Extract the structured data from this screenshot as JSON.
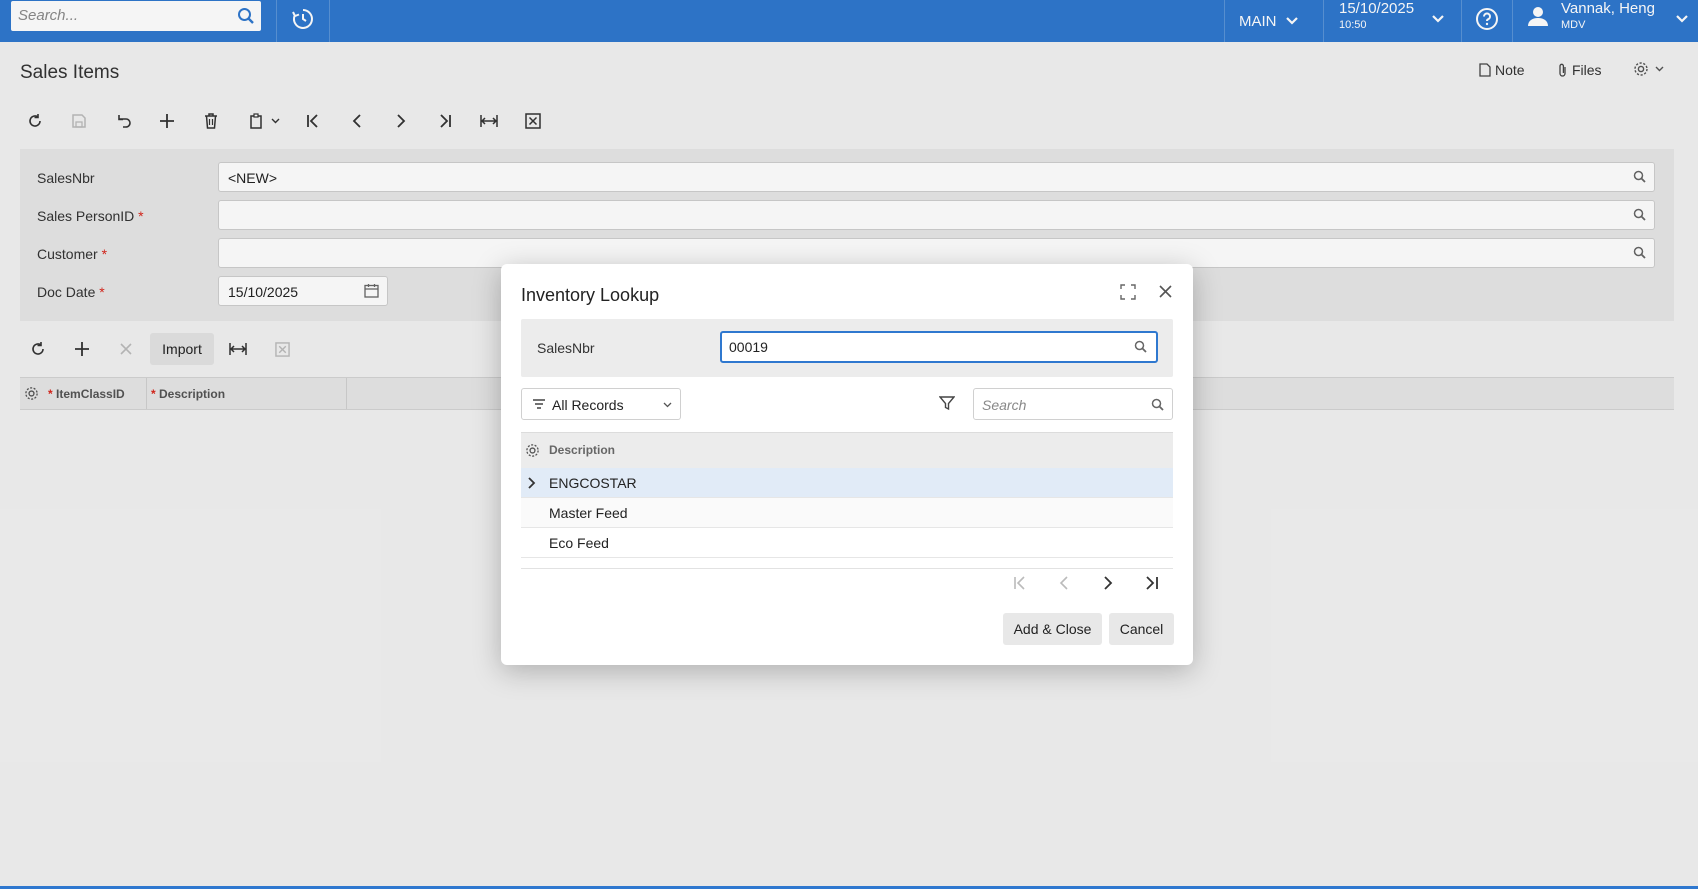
{
  "topbar": {
    "search_placeholder": "Search...",
    "branch": "MAIN",
    "date": "15/10/2025",
    "time": "10:50",
    "user_name": "Vannak, Heng",
    "user_company": "MDV"
  },
  "page": {
    "title": "Sales Items",
    "note_label": "Note",
    "files_label": "Files"
  },
  "form": {
    "salesnbr_label": "SalesNbr",
    "salesnbr_value": "<NEW>",
    "salesperson_label": "Sales PersonID",
    "customer_label": "Customer",
    "docdate_label": "Doc Date",
    "docdate_value": "15/10/2025",
    "required_mark": "*"
  },
  "details": {
    "import_label": "Import",
    "columns": [
      "ItemClassID",
      "Description"
    ]
  },
  "dialog": {
    "title": "Inventory Lookup",
    "param_label": "SalesNbr",
    "param_value": "00019",
    "filter_label": "All Records",
    "search_placeholder": "Search",
    "column_header": "Description",
    "rows": [
      "ENGCOSTAR",
      "Master Feed",
      "Eco Feed"
    ],
    "add_close_label": "Add & Close",
    "cancel_label": "Cancel"
  },
  "colors": {
    "brand_blue": "#2f78cf",
    "required_red": "#d9261c",
    "selected_row": "#e1ebf7"
  }
}
